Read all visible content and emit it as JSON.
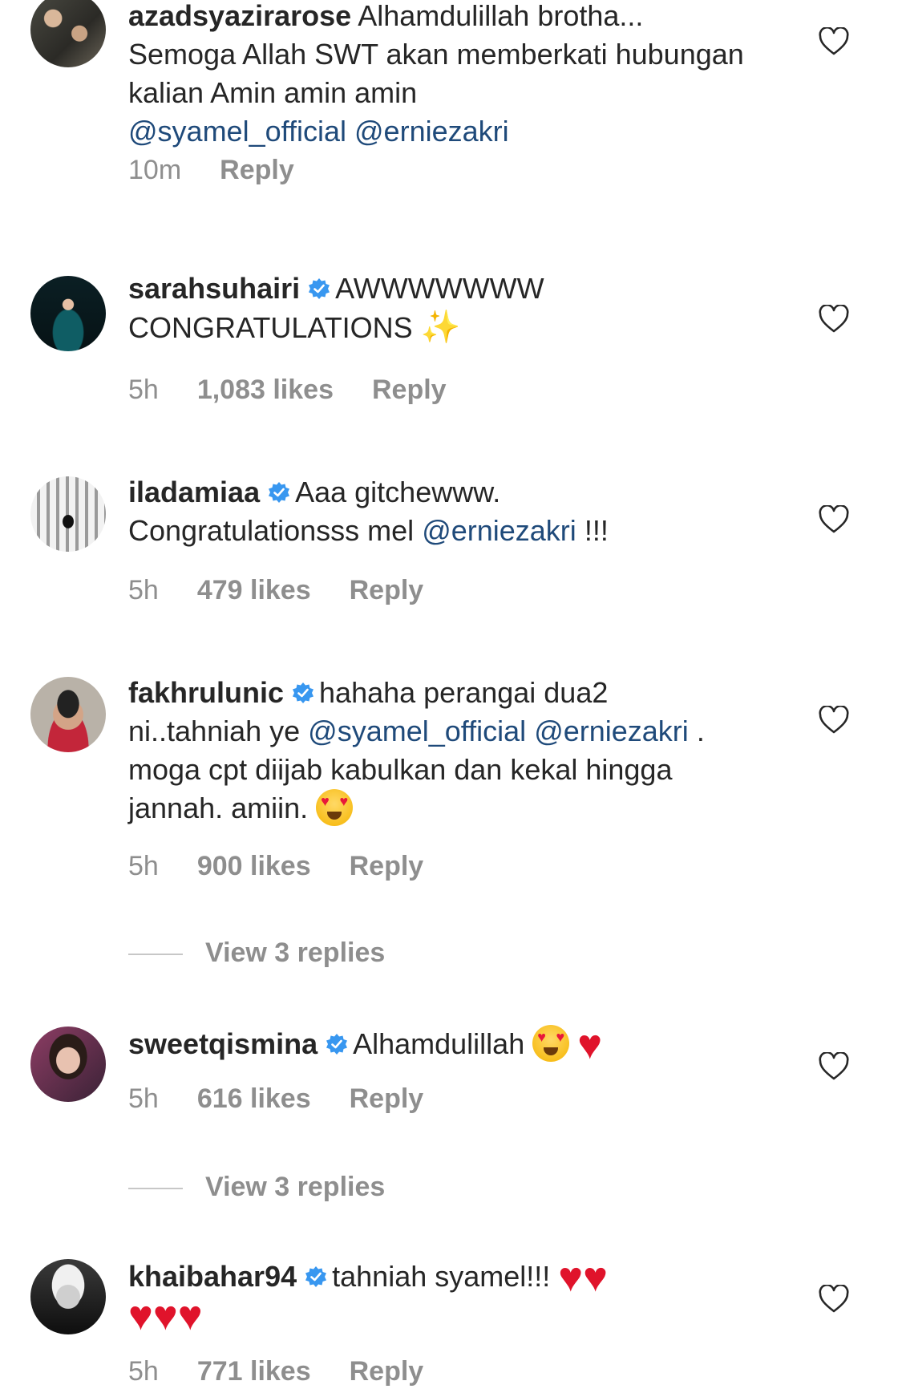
{
  "comments": [
    {
      "username": "azadsyazirarose",
      "verified": false,
      "text_1": " Alhamdulillah brotha...",
      "text_2": "Semoga Allah SWT akan memberkati hubungan kalian Amin amin amin",
      "mention_1": "@syamel_official",
      "mention_2": "@erniezakri",
      "time": "10m",
      "reply": "Reply"
    },
    {
      "username": "sarahsuhairi",
      "verified": true,
      "text_1": "AWWWWWWW CONGRATULATIONS",
      "emoji": "✨",
      "time": "5h",
      "likes": "1,083 likes",
      "reply": "Reply"
    },
    {
      "username": "iladamiaa",
      "verified": true,
      "text_1": "Aaa gitchewww.",
      "text_2": "Congratulationsss mel",
      "mention_1": "@erniezakri",
      "text_3": "!!!",
      "time": "5h",
      "likes": "479 likes",
      "reply": "Reply"
    },
    {
      "username": "fakhrulunic",
      "verified": true,
      "text_1": "hahaha perangai dua2 ni..tahniah ye",
      "mention_1": "@syamel_official",
      "mention_2": "@erniezakri",
      "text_2": ". moga cpt diijab kabulkan dan kekal hingga jannah. amiin.",
      "time": "5h",
      "likes": "900 likes",
      "reply": "Reply",
      "view_replies": "View 3 replies"
    },
    {
      "username": "sweetqismina",
      "verified": true,
      "text_1": "Alhamdulillah",
      "time": "5h",
      "likes": "616 likes",
      "reply": "Reply",
      "view_replies": "View 3 replies"
    },
    {
      "username": "khaibahar94",
      "verified": true,
      "text_1": "tahniah syamel!!!",
      "time": "5h",
      "likes": "771 likes",
      "reply": "Reply"
    }
  ],
  "icons": {
    "like": "heart-outline-icon",
    "verified": "verified-badge-icon",
    "emoji_heart_eyes": "heart-eyes-emoji",
    "emoji_red_heart": "red-heart-emoji"
  },
  "colors": {
    "mention": "#1f4a7a",
    "meta": "#8e8e8e",
    "verified": "#3897f0"
  }
}
